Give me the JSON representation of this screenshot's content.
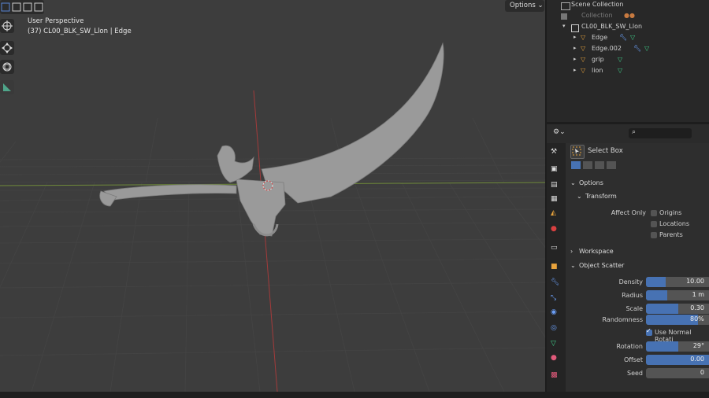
{
  "viewport": {
    "perspective": "User Perspective",
    "object_info": "(37) CL00_BLK_SW_Llon | Edge",
    "options_label": "Options"
  },
  "outliner": {
    "scene_collection": "Scene Collection",
    "collection": "Collection",
    "root_object": "CL00_BLK_SW_Llon",
    "children": [
      {
        "label": "Edge"
      },
      {
        "label": "Edge.002"
      },
      {
        "label": "grip"
      },
      {
        "label": "lion"
      }
    ]
  },
  "properties": {
    "tool_name": "Select Box",
    "options_section": "Options",
    "transform_section": "Transform",
    "affect_only_label": "Affect Only",
    "affect_only": [
      {
        "label": "Origins",
        "checked": false
      },
      {
        "label": "Locations",
        "checked": false
      },
      {
        "label": "Parents",
        "checked": false
      }
    ],
    "workspace_section": "Workspace",
    "scatter_section": "Object Scatter",
    "fields": [
      {
        "label": "Density",
        "value": "10.00",
        "fill": 0.3
      },
      {
        "label": "Radius",
        "value": "1 m",
        "fill": 0.33
      },
      {
        "label": "Scale",
        "value": "0.30",
        "fill": 0.5
      },
      {
        "label": "Randomness",
        "value": "80%",
        "fill": 0.8
      }
    ],
    "use_normal": {
      "label": "Use Normal Rotati",
      "checked": true
    },
    "fields2": [
      {
        "label": "Rotation",
        "value": "29°",
        "fill": 0.5
      },
      {
        "label": "Offset",
        "value": "0.00",
        "fill": 1.0
      },
      {
        "label": "Seed",
        "value": "0",
        "fill": 0.0
      }
    ]
  },
  "colors": {
    "accent": "#4772b3",
    "object_orange": "#e8a33c",
    "modifier_blue": "#6b9ff7",
    "mesh_green": "#3fd08a"
  }
}
